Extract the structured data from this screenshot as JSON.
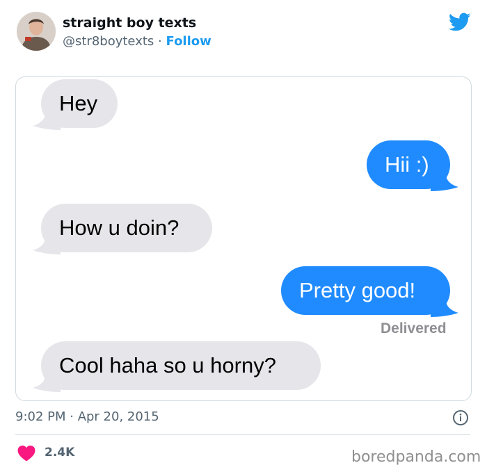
{
  "header": {
    "display_name": "straight boy texts",
    "handle": "@str8boytexts",
    "separator": "·",
    "follow_label": "Follow"
  },
  "messages": [
    {
      "direction": "received",
      "text": "Hey"
    },
    {
      "direction": "sent",
      "text": "Hii :)"
    },
    {
      "direction": "received",
      "text": "How u doin?"
    },
    {
      "direction": "sent",
      "text": "Pretty good!"
    },
    {
      "direction": "received",
      "text": "Cool haha so u horny?"
    }
  ],
  "status": {
    "delivered": "Delivered"
  },
  "footer": {
    "time": "9:02 PM",
    "date": "Apr 20, 2015",
    "timestamp": "9:02 PM · Apr 20, 2015",
    "likes": "2.4K",
    "watermark": "boredpanda.com"
  },
  "colors": {
    "sent_bubble": "#1f8bff",
    "received_bubble": "#e5e5ea",
    "twitter_blue": "#1d9bf0",
    "heart": "#f91880"
  },
  "icons": [
    "twitter-bird-icon",
    "info-icon",
    "heart-icon"
  ]
}
